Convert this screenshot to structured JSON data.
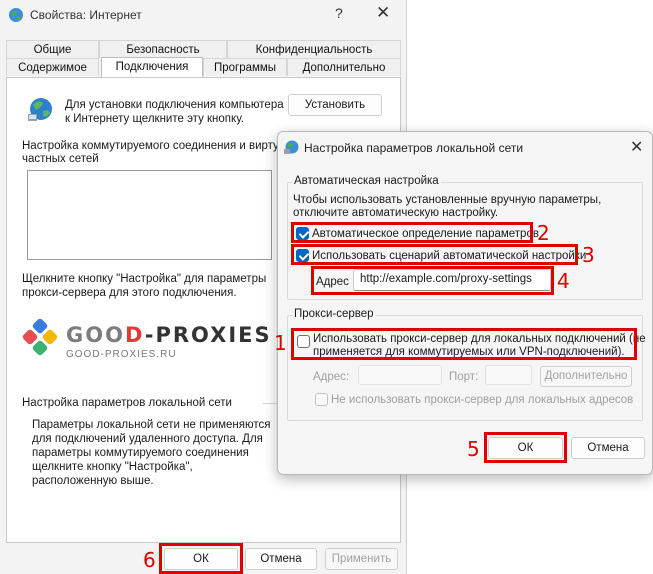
{
  "main_dialog": {
    "title": "Свойства: Интернет",
    "help": "?",
    "close": "✕",
    "tabs_row1": [
      "Общие",
      "Безопасность",
      "Конфиденциальность"
    ],
    "tabs_row2": [
      "Содержимое",
      "Подключения",
      "Программы",
      "Дополнительно"
    ],
    "setup_text_1": "Для установки подключения компьютера",
    "setup_text_2": "к Интернету щелкните эту кнопку.",
    "setup_button": "Установить",
    "dialup_heading_1": "Настройка коммутируемого соединения и виртуа",
    "dialup_heading_2": "частных сетей",
    "proxy_text_1": "Щелкните кнопку \"Настройка\" для параметры",
    "proxy_text_2": "прокси-сервера для этого подключения.",
    "logo_main_1": "GOO",
    "logo_main_2": "D",
    "logo_main_3": "-PROXIES",
    "logo_sub": "GOOD-PROXIES.RU",
    "lan_heading": "Настройка параметров локальной сети",
    "lan_text": [
      "Параметры локальной сети не применяются",
      "для подключений удаленного доступа. Для",
      "параметры коммутируемого соединения",
      "щелкните кнопку \"Настройка\",",
      "расположенную выше."
    ],
    "ok": "ОК",
    "cancel": "Отмена",
    "apply": "Применить"
  },
  "lan_dialog": {
    "title": "Настройка параметров локальной сети",
    "close": "✕",
    "auto_legend": "Автоматическая настройка",
    "auto_text_1": "Чтобы использовать установленные вручную параметры,",
    "auto_text_2": "отключите автоматическую настройку.",
    "auto_detect_label": "Автоматическое определение параметров",
    "auto_detect_checked": true,
    "auto_script_label": "Использовать сценарий автоматической настройки",
    "auto_script_checked": true,
    "address_label": "Адрес",
    "address_value": "http://example.com/proxy-settings",
    "proxy_legend": "Прокси-сервер",
    "use_proxy_label_1": "Использовать прокси-сервер для локальных подключений (не",
    "use_proxy_label_2": "применяется для коммутируемых или VPN-подключений).",
    "use_proxy_checked": false,
    "proxy_address_label": "Адрес:",
    "port_label": "Порт:",
    "advanced_button": "Дополнительно",
    "bypass_label": "Не использовать прокси-сервер для локальных адресов",
    "ok": "ОК",
    "cancel": "Отмена"
  },
  "annotations": [
    "1",
    "2",
    "3",
    "4",
    "5",
    "6"
  ],
  "colors": {
    "highlight": "#e00000",
    "accent": "#0067c0"
  }
}
